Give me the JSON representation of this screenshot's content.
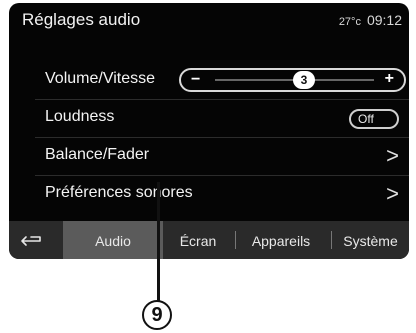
{
  "header": {
    "title": "Réglages audio",
    "temperature": "27°c",
    "time": "09:12"
  },
  "rows": [
    {
      "label": "Volume/Vitesse",
      "minus": "−",
      "plus": "+",
      "value": "3"
    },
    {
      "label": "Loudness",
      "toggle": "Off"
    },
    {
      "label": "Balance/Fader",
      "chevron": ">"
    },
    {
      "label": "Préférences sonores",
      "chevron": ">"
    }
  ],
  "tabs": [
    {
      "label": "Audio",
      "active": true
    },
    {
      "label": "Écran"
    },
    {
      "label": "Appareils"
    },
    {
      "label": "Système"
    }
  ],
  "callout": {
    "number": "9"
  },
  "icons": {
    "back": "back-arrow-icon"
  }
}
